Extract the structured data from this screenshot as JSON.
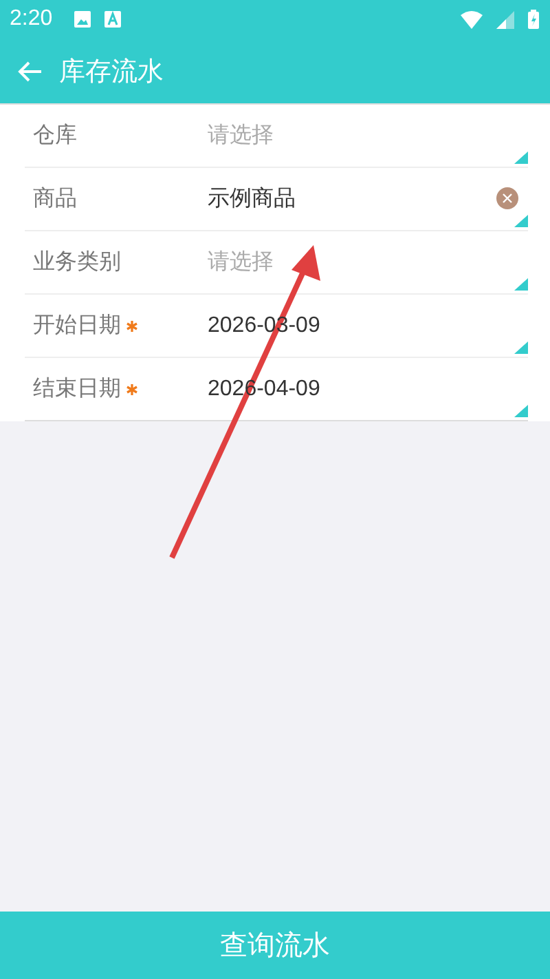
{
  "status_bar": {
    "time": "2:20"
  },
  "toolbar": {
    "title": "库存流水"
  },
  "fields": [
    {
      "label": "仓库",
      "required": false,
      "placeholder": "请选择",
      "clearable": false
    },
    {
      "label": "商品",
      "required": false,
      "value": "示例商品",
      "clearable": true
    },
    {
      "label": "业务类别",
      "required": false,
      "placeholder": "请选择",
      "clearable": false
    },
    {
      "label": "开始日期",
      "required": true,
      "value": "2026-03-09",
      "clearable": false
    },
    {
      "label": "结束日期",
      "required": true,
      "value": "2026-04-09",
      "clearable": false
    }
  ],
  "submit_button": {
    "label": "查询流水"
  }
}
